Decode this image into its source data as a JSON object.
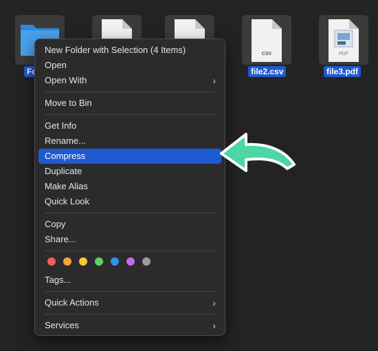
{
  "desktop": {
    "files": [
      {
        "name": "Fo",
        "type": "folder"
      },
      {
        "name": "",
        "type": "document"
      },
      {
        "name": "",
        "type": "document"
      },
      {
        "name": "file2.csv",
        "type": "csv",
        "badge": "CSV"
      },
      {
        "name": "file3.pdf",
        "type": "pdf",
        "badge": "PDF"
      }
    ]
  },
  "context_menu": {
    "items": [
      {
        "label": "New Folder with Selection (4 Items)"
      },
      {
        "label": "Open"
      },
      {
        "label": "Open With",
        "submenu": true
      },
      {
        "label": "Move to Bin"
      },
      {
        "label": "Get Info"
      },
      {
        "label": "Rename..."
      },
      {
        "label": "Compress",
        "highlighted": true
      },
      {
        "label": "Duplicate"
      },
      {
        "label": "Make Alias"
      },
      {
        "label": "Quick Look"
      },
      {
        "label": "Copy"
      },
      {
        "label": "Share..."
      },
      {
        "label": "Tags..."
      },
      {
        "label": "Quick Actions",
        "submenu": true
      },
      {
        "label": "Services",
        "submenu": true
      }
    ],
    "submenu_glyph": "›",
    "tag_colors": [
      {
        "name": "red",
        "color": "#ec5f5d"
      },
      {
        "name": "orange",
        "color": "#f0a33a"
      },
      {
        "name": "yellow",
        "color": "#f5c833"
      },
      {
        "name": "green",
        "color": "#5ed25e"
      },
      {
        "name": "blue",
        "color": "#3b8fe8"
      },
      {
        "name": "purple",
        "color": "#c36ae8"
      },
      {
        "name": "gray",
        "color": "#9c9c9c"
      }
    ]
  },
  "annotation": {
    "arrow_icon": "pointer-arrow-icon",
    "arrow_color": "#4cd6a4"
  },
  "colors": {
    "selection": "#1f5bd0",
    "menu_background": "#2b2b2d",
    "desktop_background": "#232323"
  }
}
